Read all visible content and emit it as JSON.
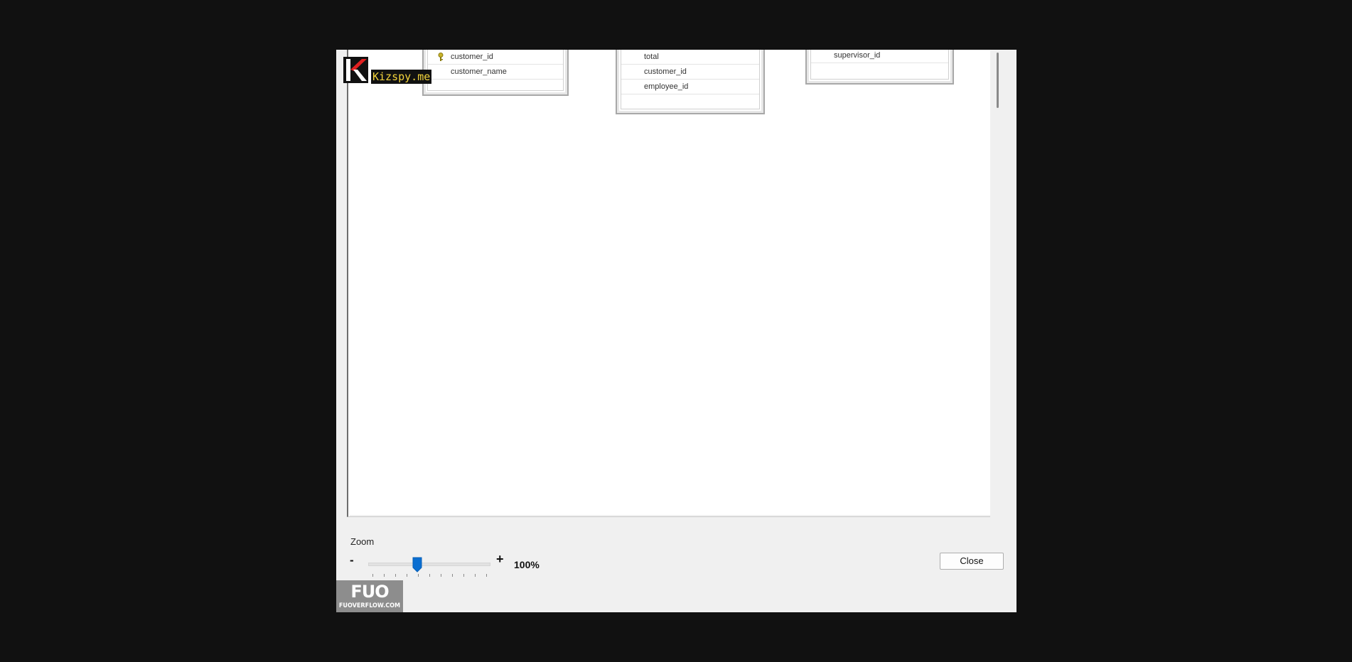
{
  "watermark": {
    "text": "Kizspy.me"
  },
  "diagram": {
    "tables": [
      {
        "columns": [
          {
            "name": "customer_id",
            "primary_key": true
          },
          {
            "name": "customer_name",
            "primary_key": false
          }
        ]
      },
      {
        "columns": [
          {
            "name": "total",
            "primary_key": false
          },
          {
            "name": "customer_id",
            "primary_key": false
          },
          {
            "name": "employee_id",
            "primary_key": false
          }
        ]
      },
      {
        "columns": [
          {
            "name": "supervisor_id",
            "primary_key": false
          }
        ]
      }
    ]
  },
  "zoom": {
    "label": "Zoom",
    "minus": "-",
    "plus": "+",
    "value": "100%",
    "slider_fraction": 0.4
  },
  "buttons": {
    "close_label": "Close"
  },
  "logo": {
    "big": "FUO",
    "small": "FUOVERFLOW.COM"
  },
  "icons": {
    "key": "key-icon"
  }
}
